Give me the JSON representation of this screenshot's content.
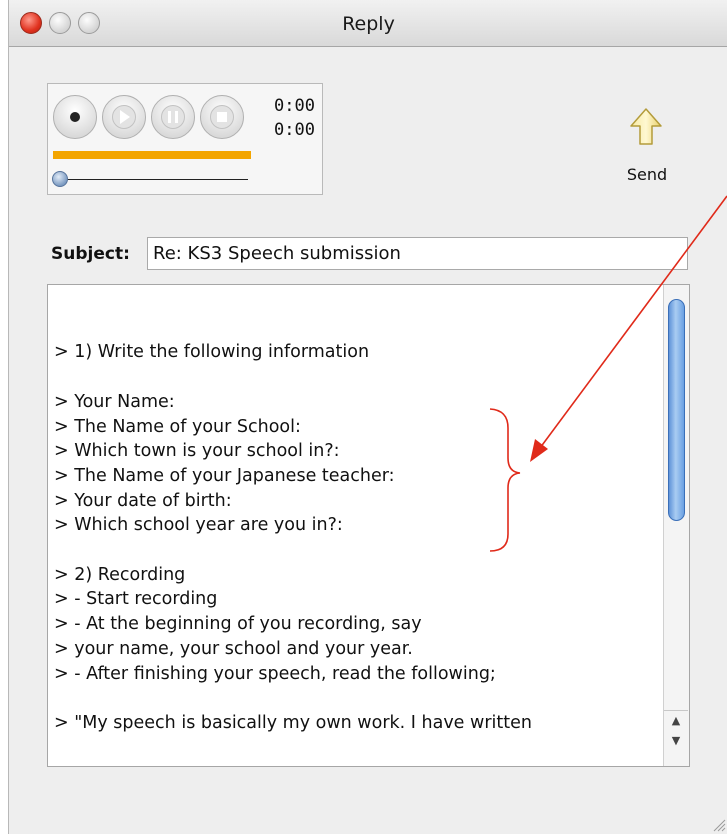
{
  "window": {
    "title": "Reply"
  },
  "recorder": {
    "elapsed_time": "0:00",
    "total_time": "0:00",
    "progress_fraction": 1.0,
    "slider_fraction": 0.0
  },
  "toolbar": {
    "send_label": "Send"
  },
  "subject": {
    "label": "Subject:",
    "value": "Re: KS3 Speech submission"
  },
  "message": {
    "lines": [
      "",
      "",
      "> 1) Write the following information",
      "",
      "> Your Name:",
      "> The Name of your School:",
      "> Which town is your school in?:",
      "> The Name of your Japanese teacher:",
      "> Your date of birth:",
      "> Which school year are you in?:",
      "",
      "> 2) Recording",
      "> - Start recording",
      "> - At the beginning of you recording, say",
      "> your name, your school and your year.",
      "> - After finishing your speech, read the following;",
      "",
      "> \"My speech is basically my own work. I have written"
    ]
  },
  "colors": {
    "progress": "#f3a500",
    "annotation": "#e02a1a",
    "scroll_thumb": "#6aa0e2"
  },
  "icons": {
    "close": "close-icon",
    "minimize": "minimize-icon",
    "maximize": "maximize-icon",
    "record": "record-icon",
    "play": "play-icon",
    "pause": "pause-icon",
    "stop": "stop-icon",
    "send": "up-arrow-icon"
  }
}
